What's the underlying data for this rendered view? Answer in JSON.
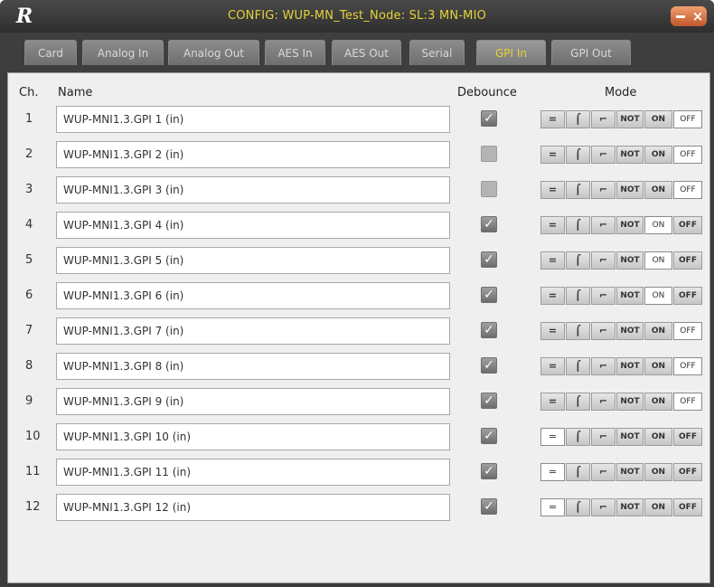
{
  "window": {
    "title": "CONFIG: WUP-MN_Test_Node: SL:3 MN-MIO",
    "logo": "R"
  },
  "tabs": [
    {
      "label": "Card",
      "active": false
    },
    {
      "label": "Analog In",
      "active": false
    },
    {
      "label": "Analog Out",
      "active": false
    },
    {
      "label": "AES In",
      "active": false
    },
    {
      "label": "AES Out",
      "active": false
    },
    {
      "label": "Serial",
      "active": false
    },
    {
      "label": "GPI In",
      "active": true
    },
    {
      "label": "GPI Out",
      "active": false
    }
  ],
  "headers": {
    "ch": "Ch.",
    "name": "Name",
    "debounce": "Debounce",
    "mode": "Mode"
  },
  "mode_buttons": [
    "=",
    "⌠",
    "⌐",
    "NOT",
    "ON",
    "OFF"
  ],
  "mode_icons": [
    "level-icon",
    "rising-edge-icon",
    "falling-edge-icon",
    "not-button",
    "on-button",
    "off-button"
  ],
  "rows": [
    {
      "ch": "1",
      "name": "WUP-MNI1.3.GPI 1 (in)",
      "debounce": true,
      "selected": "OFF"
    },
    {
      "ch": "2",
      "name": "WUP-MNI1.3.GPI 2 (in)",
      "debounce": false,
      "selected": "OFF"
    },
    {
      "ch": "3",
      "name": "WUP-MNI1.3.GPI 3 (in)",
      "debounce": false,
      "selected": "OFF"
    },
    {
      "ch": "4",
      "name": "WUP-MNI1.3.GPI 4 (in)",
      "debounce": true,
      "selected": "ON"
    },
    {
      "ch": "5",
      "name": "WUP-MNI1.3.GPI 5 (in)",
      "debounce": true,
      "selected": "ON"
    },
    {
      "ch": "6",
      "name": "WUP-MNI1.3.GPI 6 (in)",
      "debounce": true,
      "selected": "ON"
    },
    {
      "ch": "7",
      "name": "WUP-MNI1.3.GPI 7 (in)",
      "debounce": true,
      "selected": "OFF"
    },
    {
      "ch": "8",
      "name": "WUP-MNI1.3.GPI 8 (in)",
      "debounce": true,
      "selected": "OFF"
    },
    {
      "ch": "9",
      "name": "WUP-MNI1.3.GPI 9 (in)",
      "debounce": true,
      "selected": "OFF"
    },
    {
      "ch": "10",
      "name": "WUP-MNI1.3.GPI 10 (in)",
      "debounce": true,
      "selected": "="
    },
    {
      "ch": "11",
      "name": "WUP-MNI1.3.GPI 11 (in)",
      "debounce": true,
      "selected": "="
    },
    {
      "ch": "12",
      "name": "WUP-MNI1.3.GPI 12 (in)",
      "debounce": true,
      "selected": "="
    }
  ],
  "colors": {
    "title_text": "#e6d23a",
    "active_tab_text": "#e6d23a",
    "frame": "#3c3c3c",
    "panel": "#efefef"
  }
}
